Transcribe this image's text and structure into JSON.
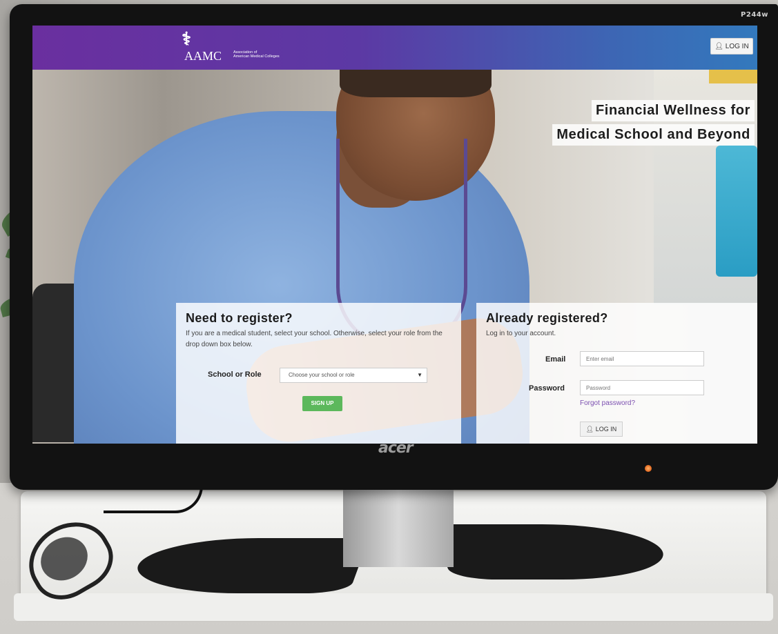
{
  "monitor": {
    "model": "P244w",
    "brand": "acer"
  },
  "site": {
    "logo": {
      "wordmark": "AAMC",
      "subtitle_line1": "Association of",
      "subtitle_line2": "American Medical Colleges"
    },
    "header_login_label": "LOG IN",
    "headline": {
      "line1": "Financial Wellness for",
      "line2": "Medical School and Beyond"
    },
    "register": {
      "title": "Need to register?",
      "description": "If you are a medical student, select your school. Otherwise, select your role from the drop down box below.",
      "field_label": "School or Role",
      "select_value": "Choose your school or role",
      "signup_label": "SIGN UP"
    },
    "login": {
      "title": "Already registered?",
      "description": "Log in to your account.",
      "email_label": "Email",
      "email_placeholder": "Enter email",
      "password_label": "Password",
      "password_placeholder": "Password",
      "forgot_label": "Forgot password?",
      "login_label": "LOG IN"
    }
  },
  "colors": {
    "header_gradient_start": "#6a2f9f",
    "header_gradient_end": "#3379bd",
    "signup_button": "#5cb85c",
    "link": "#7b4fb0"
  },
  "icons": {
    "user": "user-icon",
    "dropdown": "chevron-down-icon"
  }
}
